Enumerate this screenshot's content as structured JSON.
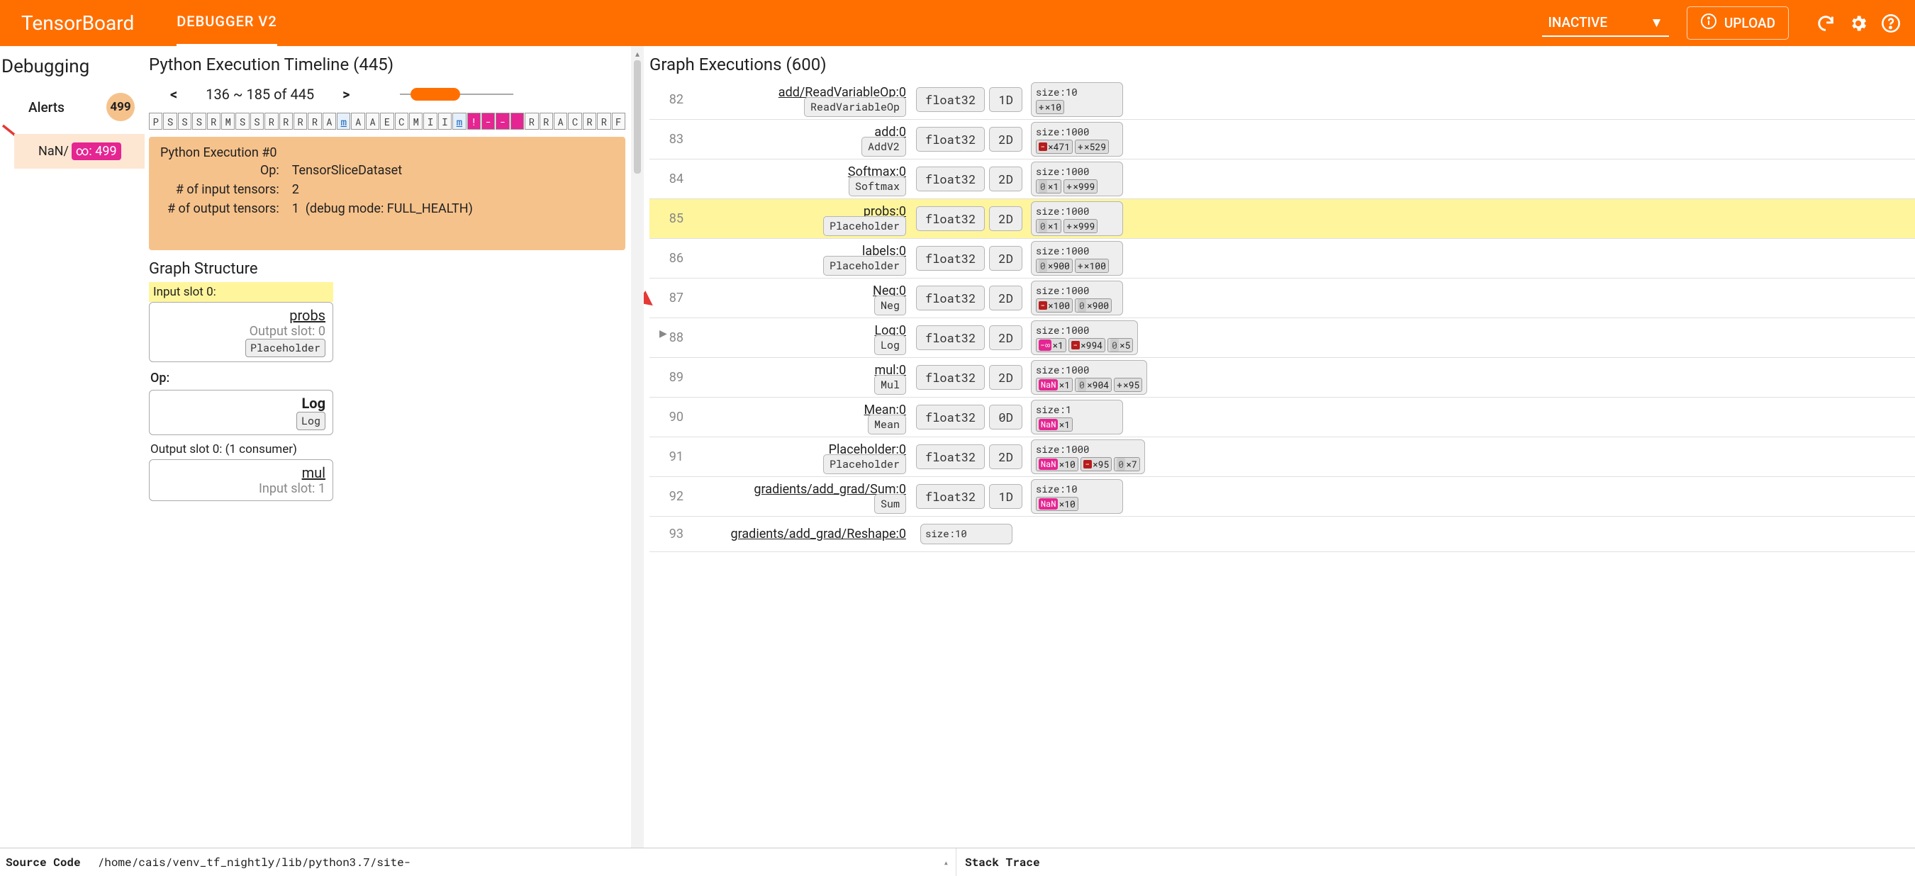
{
  "header": {
    "brand": "TensorBoard",
    "tab": "DEBUGGER V2",
    "mode": "INACTIVE",
    "upload": "UPLOAD"
  },
  "sidebar": {
    "title": "Debugging",
    "alerts_label": "Alerts",
    "alerts_count": "499",
    "alert_item_label": "NaN/",
    "alert_item_count": "∞: 499"
  },
  "timeline": {
    "title": "Python Execution Timeline (445)",
    "prev": "<",
    "next": ">",
    "range": "136 ~ 185 of 445",
    "cells": [
      "P",
      "S",
      "S",
      "S",
      "R",
      "M",
      "S",
      "S",
      "R",
      "R",
      "R",
      "R",
      "A",
      "m",
      "A",
      "A",
      "E",
      "C",
      "M",
      "I",
      "I",
      "m",
      "!",
      "-",
      "-",
      "",
      "R",
      "R",
      "A",
      "C",
      "R",
      "R",
      "F"
    ],
    "cellStyles": [
      "",
      "",
      "",
      "",
      "",
      "",
      "",
      "",
      "",
      "",
      "",
      "",
      "",
      "blue",
      "",
      "",
      "",
      "",
      "",
      "",
      "",
      "blue",
      "pink",
      "pink",
      "pink",
      "pink",
      "",
      "",
      "",
      "",
      "",
      "",
      ""
    ]
  },
  "exec": {
    "header": "Python Execution #0",
    "op_label": "Op:",
    "op": "TensorSliceDataset",
    "in_label": "# of input tensors:",
    "in": "2",
    "out_label": "# of output tensors:",
    "out": "1",
    "out_note": "(debug mode: FULL_HEALTH)"
  },
  "graph_struct": {
    "title": "Graph Structure",
    "input_slot": "Input slot 0:",
    "input_name": "probs",
    "input_sub": "Output slot: 0",
    "input_op": "Placeholder",
    "op_label": "Op:",
    "op_name": "Log",
    "op_chip": "Log",
    "output_slot": "Output slot 0: (1 consumer)",
    "output_name": "mul",
    "output_sub": "Input slot: 1"
  },
  "ge": {
    "title": "Graph Executions (600)",
    "rows": [
      {
        "idx": "82",
        "name": "add/ReadVariableOp:0",
        "op": "ReadVariableOp",
        "dtype": "float32",
        "dim": "1D",
        "size": "size:10",
        "marks": [
          [
            "+",
            "×10"
          ]
        ]
      },
      {
        "idx": "83",
        "name": "add:0",
        "op": "AddV2",
        "dtype": "float32",
        "dim": "2D",
        "size": "size:1000",
        "marks": [
          [
            "-",
            "×471"
          ],
          [
            "+",
            "×529"
          ]
        ]
      },
      {
        "idx": "84",
        "name": "Softmax:0",
        "op": "Softmax",
        "dtype": "float32",
        "dim": "2D",
        "size": "size:1000",
        "marks": [
          [
            "0",
            "×1"
          ],
          [
            "+",
            "×999"
          ]
        ]
      },
      {
        "idx": "85",
        "name": "probs:0",
        "op": "Placeholder",
        "dtype": "float32",
        "dim": "2D",
        "size": "size:1000",
        "marks": [
          [
            "0",
            "×1"
          ],
          [
            "+",
            "×999"
          ]
        ],
        "hl": true
      },
      {
        "idx": "86",
        "name": "labels:0",
        "op": "Placeholder",
        "dtype": "float32",
        "dim": "2D",
        "size": "size:1000",
        "marks": [
          [
            "0",
            "×900"
          ],
          [
            "+",
            "×100"
          ]
        ]
      },
      {
        "idx": "87",
        "name": "Neg:0",
        "op": "Neg",
        "dtype": "float32",
        "dim": "2D",
        "size": "size:1000",
        "marks": [
          [
            "-",
            "×100"
          ],
          [
            "0",
            "×900"
          ]
        ]
      },
      {
        "idx": "88",
        "name": "Log:0",
        "op": "Log",
        "dtype": "float32",
        "dim": "2D",
        "size": "size:1000",
        "marks": [
          [
            "-∞",
            "×1"
          ],
          [
            "-",
            "×994"
          ],
          [
            "0",
            "×5"
          ]
        ],
        "tri": true,
        "arrow": true
      },
      {
        "idx": "89",
        "name": "mul:0",
        "op": "Mul",
        "dtype": "float32",
        "dim": "2D",
        "size": "size:1000",
        "marks": [
          [
            "NaN",
            "×1"
          ],
          [
            "0",
            "×904"
          ],
          [
            "+",
            "×95"
          ]
        ]
      },
      {
        "idx": "90",
        "name": "Mean:0",
        "op": "Mean",
        "dtype": "float32",
        "dim": "0D",
        "size": "size:1",
        "marks": [
          [
            "NaN",
            "×1"
          ]
        ]
      },
      {
        "idx": "91",
        "name": "Placeholder:0",
        "op": "Placeholder",
        "dtype": "float32",
        "dim": "2D",
        "size": "size:1000",
        "marks": [
          [
            "NaN",
            "×10"
          ],
          [
            "-",
            "×95"
          ],
          [
            "0",
            "×7"
          ]
        ]
      },
      {
        "idx": "92",
        "name": "gradients/add_grad/Sum:0",
        "op": "Sum",
        "dtype": "float32",
        "dim": "1D",
        "size": "size:10",
        "marks": [
          [
            "NaN",
            "×10"
          ]
        ]
      },
      {
        "idx": "93",
        "name": "gradients/add_grad/Reshape:0",
        "op": "",
        "dtype": "",
        "dim": "",
        "size": "size:10",
        "marks": []
      }
    ]
  },
  "footer": {
    "src_label": "Source Code",
    "src_path": "/home/cais/venv_tf_nightly/lib/python3.7/site-",
    "stack_label": "Stack Trace"
  }
}
